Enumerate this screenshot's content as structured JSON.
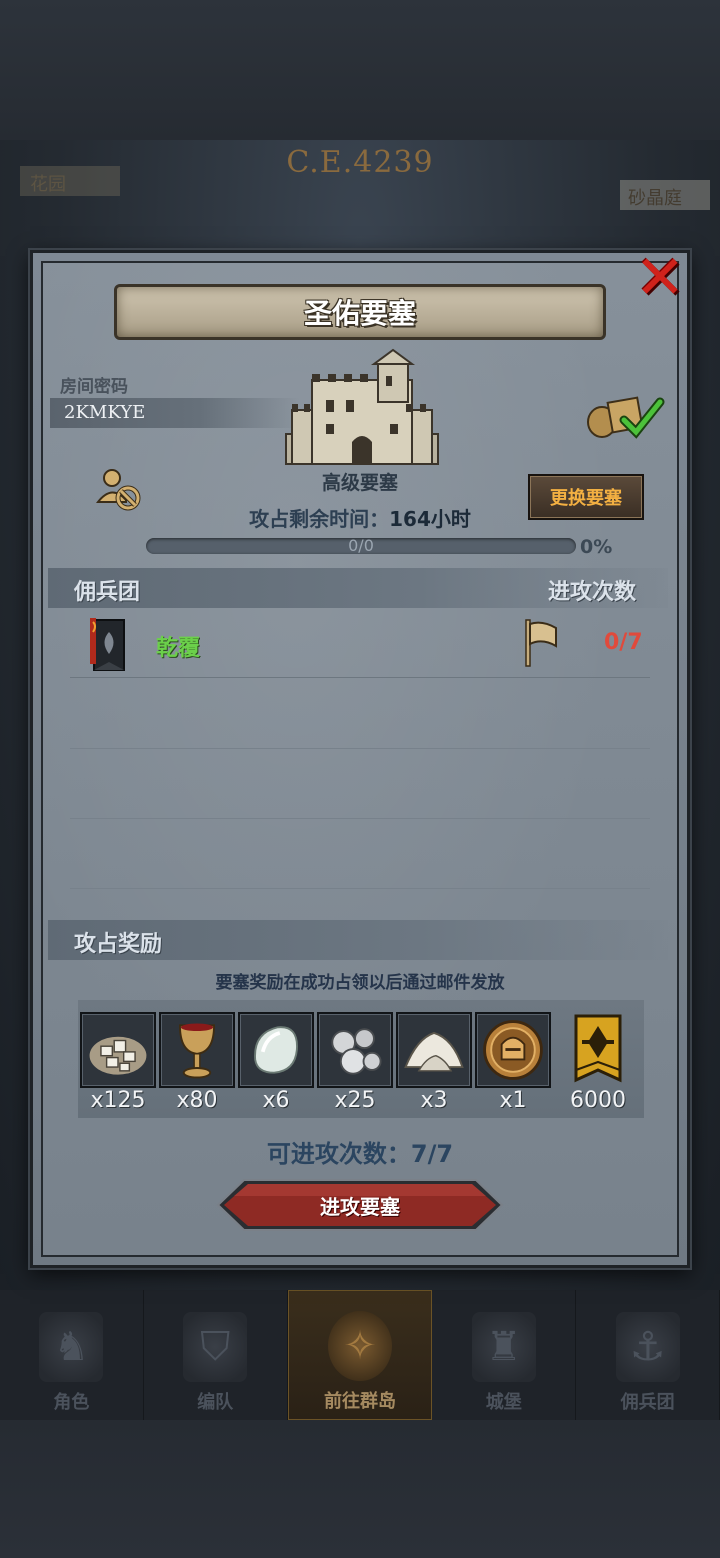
{
  "background": {
    "era_label": "C.E.4239",
    "side_left_label": "花园",
    "side_right_label": "砂晶庭"
  },
  "dialog": {
    "title": "圣佑要塞",
    "close_icon": "close-x-icon",
    "room": {
      "label": "房间密码",
      "code": "2KMKYE"
    },
    "fortress": {
      "grade": "高级要塞",
      "change_button": "更换要塞",
      "time_remaining_label": "攻占剩余时间：",
      "time_remaining_value": "164小时",
      "progress_text": "0/0",
      "progress_percent": "0%",
      "progress_fraction": 0
    },
    "mercenary_section": {
      "title": "佣兵团",
      "attacks_header": "进攻次数",
      "rows": [
        {
          "name": "乾覆",
          "attacks": "0/7"
        }
      ]
    },
    "reward_section": {
      "title": "攻占奖励",
      "note": "要塞奖励在成功占领以后通过邮件发放",
      "items": [
        {
          "icon": "stone-ore-icon",
          "qty": "x125"
        },
        {
          "icon": "goblet-icon",
          "qty": "x80"
        },
        {
          "icon": "moonstone-icon",
          "qty": "x6"
        },
        {
          "icon": "silver-ore-icon",
          "qty": "x25"
        },
        {
          "icon": "salt-pile-icon",
          "qty": "x3"
        },
        {
          "icon": "knight-helmet-medal-icon",
          "qty": "x1"
        },
        {
          "icon": "banner-emblem-icon",
          "qty": "6000"
        }
      ]
    },
    "attacks_left_label": "可进攻次数：7/7",
    "attack_button": "进攻要塞"
  },
  "bottom_nav": {
    "items": [
      {
        "label": "角色",
        "icon": "knight-icon",
        "active": false
      },
      {
        "label": "编队",
        "icon": "helmet-icon",
        "active": false
      },
      {
        "label": "前往群岛",
        "icon": "island-compass-icon",
        "active": true
      },
      {
        "label": "城堡",
        "icon": "castle-icon",
        "active": false
      },
      {
        "label": "佣兵团",
        "icon": "ship-icon",
        "active": false
      }
    ]
  },
  "colors": {
    "accent_gold": "#f3b042",
    "merc_name_green": "#6bd04a",
    "attack_count_red": "#e04a3c",
    "close_red": "#d0221b"
  }
}
